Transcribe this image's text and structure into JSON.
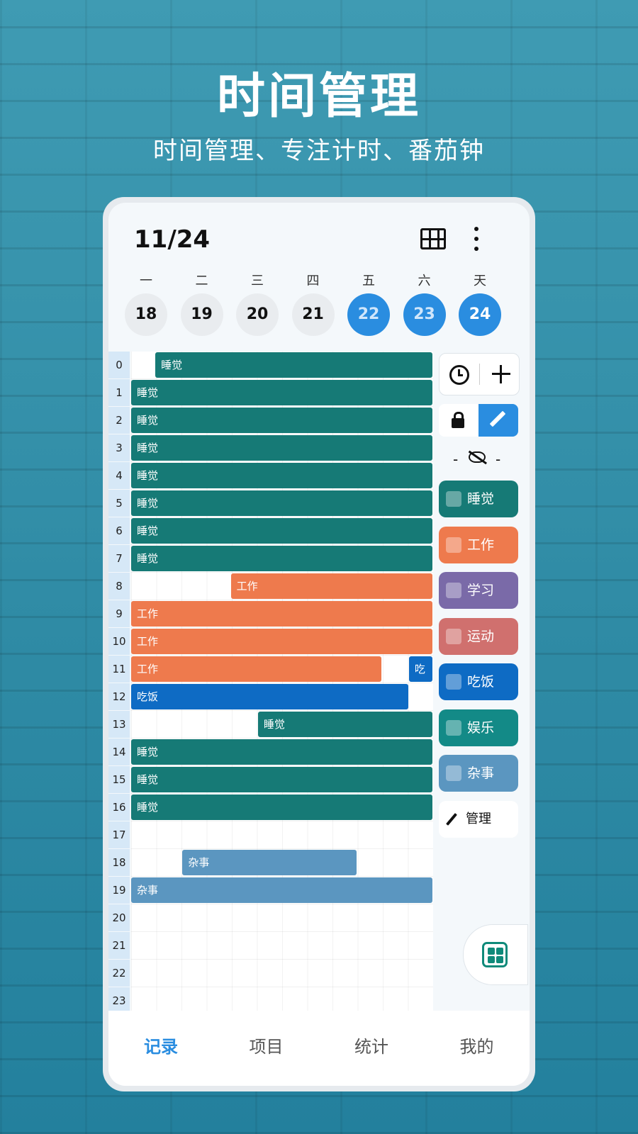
{
  "promo": {
    "title": "时间管理",
    "subtitle": "时间管理、专注计时、番茄钟"
  },
  "header": {
    "date": "11/24",
    "grid_icon": "grid-icon",
    "more_icon": "more-vertical-icon"
  },
  "week": [
    {
      "weekday": "一",
      "day": "18",
      "active": false
    },
    {
      "weekday": "二",
      "day": "19",
      "active": false
    },
    {
      "weekday": "三",
      "day": "20",
      "active": false
    },
    {
      "weekday": "四",
      "day": "21",
      "active": false
    },
    {
      "weekday": "五",
      "day": "22",
      "active": true
    },
    {
      "weekday": "六",
      "day": "23",
      "active": true
    },
    {
      "weekday": "天",
      "day": "24",
      "active": true
    }
  ],
  "hours": [
    "0",
    "1",
    "2",
    "3",
    "4",
    "5",
    "6",
    "7",
    "8",
    "9",
    "10",
    "11",
    "12",
    "13",
    "14",
    "15",
    "16",
    "17",
    "18",
    "19",
    "20",
    "21",
    "22",
    "23"
  ],
  "colors": {
    "sleep": "#167a76",
    "work": "#ee7a4d",
    "study": "#7a6aa8",
    "sport": "#d0706e",
    "eat": "#0e6bc4",
    "fun": "#138a87",
    "misc": "#5b96c0",
    "accent": "#2a8de0"
  },
  "timeline_blocks": [
    {
      "hour": 0,
      "start": 0.08,
      "end": 1.0,
      "label": "睡觉",
      "cat": "sleep"
    },
    {
      "hour": 1,
      "start": 0.0,
      "end": 1.0,
      "label": "睡觉",
      "cat": "sleep"
    },
    {
      "hour": 2,
      "start": 0.0,
      "end": 1.0,
      "label": "睡觉",
      "cat": "sleep"
    },
    {
      "hour": 3,
      "start": 0.0,
      "end": 1.0,
      "label": "睡觉",
      "cat": "sleep"
    },
    {
      "hour": 4,
      "start": 0.0,
      "end": 1.0,
      "label": "睡觉",
      "cat": "sleep"
    },
    {
      "hour": 5,
      "start": 0.0,
      "end": 1.0,
      "label": "睡觉",
      "cat": "sleep"
    },
    {
      "hour": 6,
      "start": 0.0,
      "end": 1.0,
      "label": "睡觉",
      "cat": "sleep"
    },
    {
      "hour": 7,
      "start": 0.0,
      "end": 1.0,
      "label": "睡觉",
      "cat": "sleep"
    },
    {
      "hour": 8,
      "start": 0.33,
      "end": 1.0,
      "label": "工作",
      "cat": "work"
    },
    {
      "hour": 9,
      "start": 0.0,
      "end": 1.0,
      "label": "工作",
      "cat": "work"
    },
    {
      "hour": 10,
      "start": 0.0,
      "end": 1.0,
      "label": "工作",
      "cat": "work"
    },
    {
      "hour": 11,
      "start": 0.0,
      "end": 0.83,
      "label": "工作",
      "cat": "work"
    },
    {
      "hour": 11,
      "start": 0.92,
      "end": 1.0,
      "label": "吃",
      "cat": "eat"
    },
    {
      "hour": 12,
      "start": 0.0,
      "end": 0.92,
      "label": "吃饭",
      "cat": "eat"
    },
    {
      "hour": 13,
      "start": 0.42,
      "end": 1.0,
      "label": "睡觉",
      "cat": "sleep"
    },
    {
      "hour": 14,
      "start": 0.0,
      "end": 1.0,
      "label": "睡觉",
      "cat": "sleep"
    },
    {
      "hour": 15,
      "start": 0.0,
      "end": 1.0,
      "label": "睡觉",
      "cat": "sleep"
    },
    {
      "hour": 16,
      "start": 0.0,
      "end": 1.0,
      "label": "睡觉",
      "cat": "sleep"
    },
    {
      "hour": 18,
      "start": 0.17,
      "end": 0.75,
      "label": "杂事",
      "cat": "misc"
    },
    {
      "hour": 19,
      "start": 0.0,
      "end": 1.0,
      "label": "杂事",
      "cat": "misc"
    }
  ],
  "side": {
    "clock_icon": "clock-icon",
    "add_icon": "plus-icon",
    "lock_icon": "lock-icon",
    "edit_icon": "pencil-icon",
    "visibility_icon": "eye-off-icon",
    "dash": "-",
    "categories": [
      {
        "label": "睡觉",
        "cat": "sleep",
        "icon": "plant-icon"
      },
      {
        "label": "工作",
        "cat": "work",
        "icon": "desk-icon"
      },
      {
        "label": "学习",
        "cat": "study",
        "icon": "book-icon"
      },
      {
        "label": "运动",
        "cat": "sport",
        "icon": "runner-icon"
      },
      {
        "label": "吃饭",
        "cat": "eat",
        "icon": "bowl-icon"
      },
      {
        "label": "娱乐",
        "cat": "fun",
        "icon": "phone-icon"
      },
      {
        "label": "杂事",
        "cat": "misc",
        "icon": "bag-icon"
      }
    ],
    "manage_label": "管理"
  },
  "fab_icon": "apps-grid-icon",
  "nav": {
    "tabs": [
      {
        "label": "记录",
        "active": true
      },
      {
        "label": "项目",
        "active": false
      },
      {
        "label": "统计",
        "active": false
      },
      {
        "label": "我的",
        "active": false
      }
    ]
  }
}
